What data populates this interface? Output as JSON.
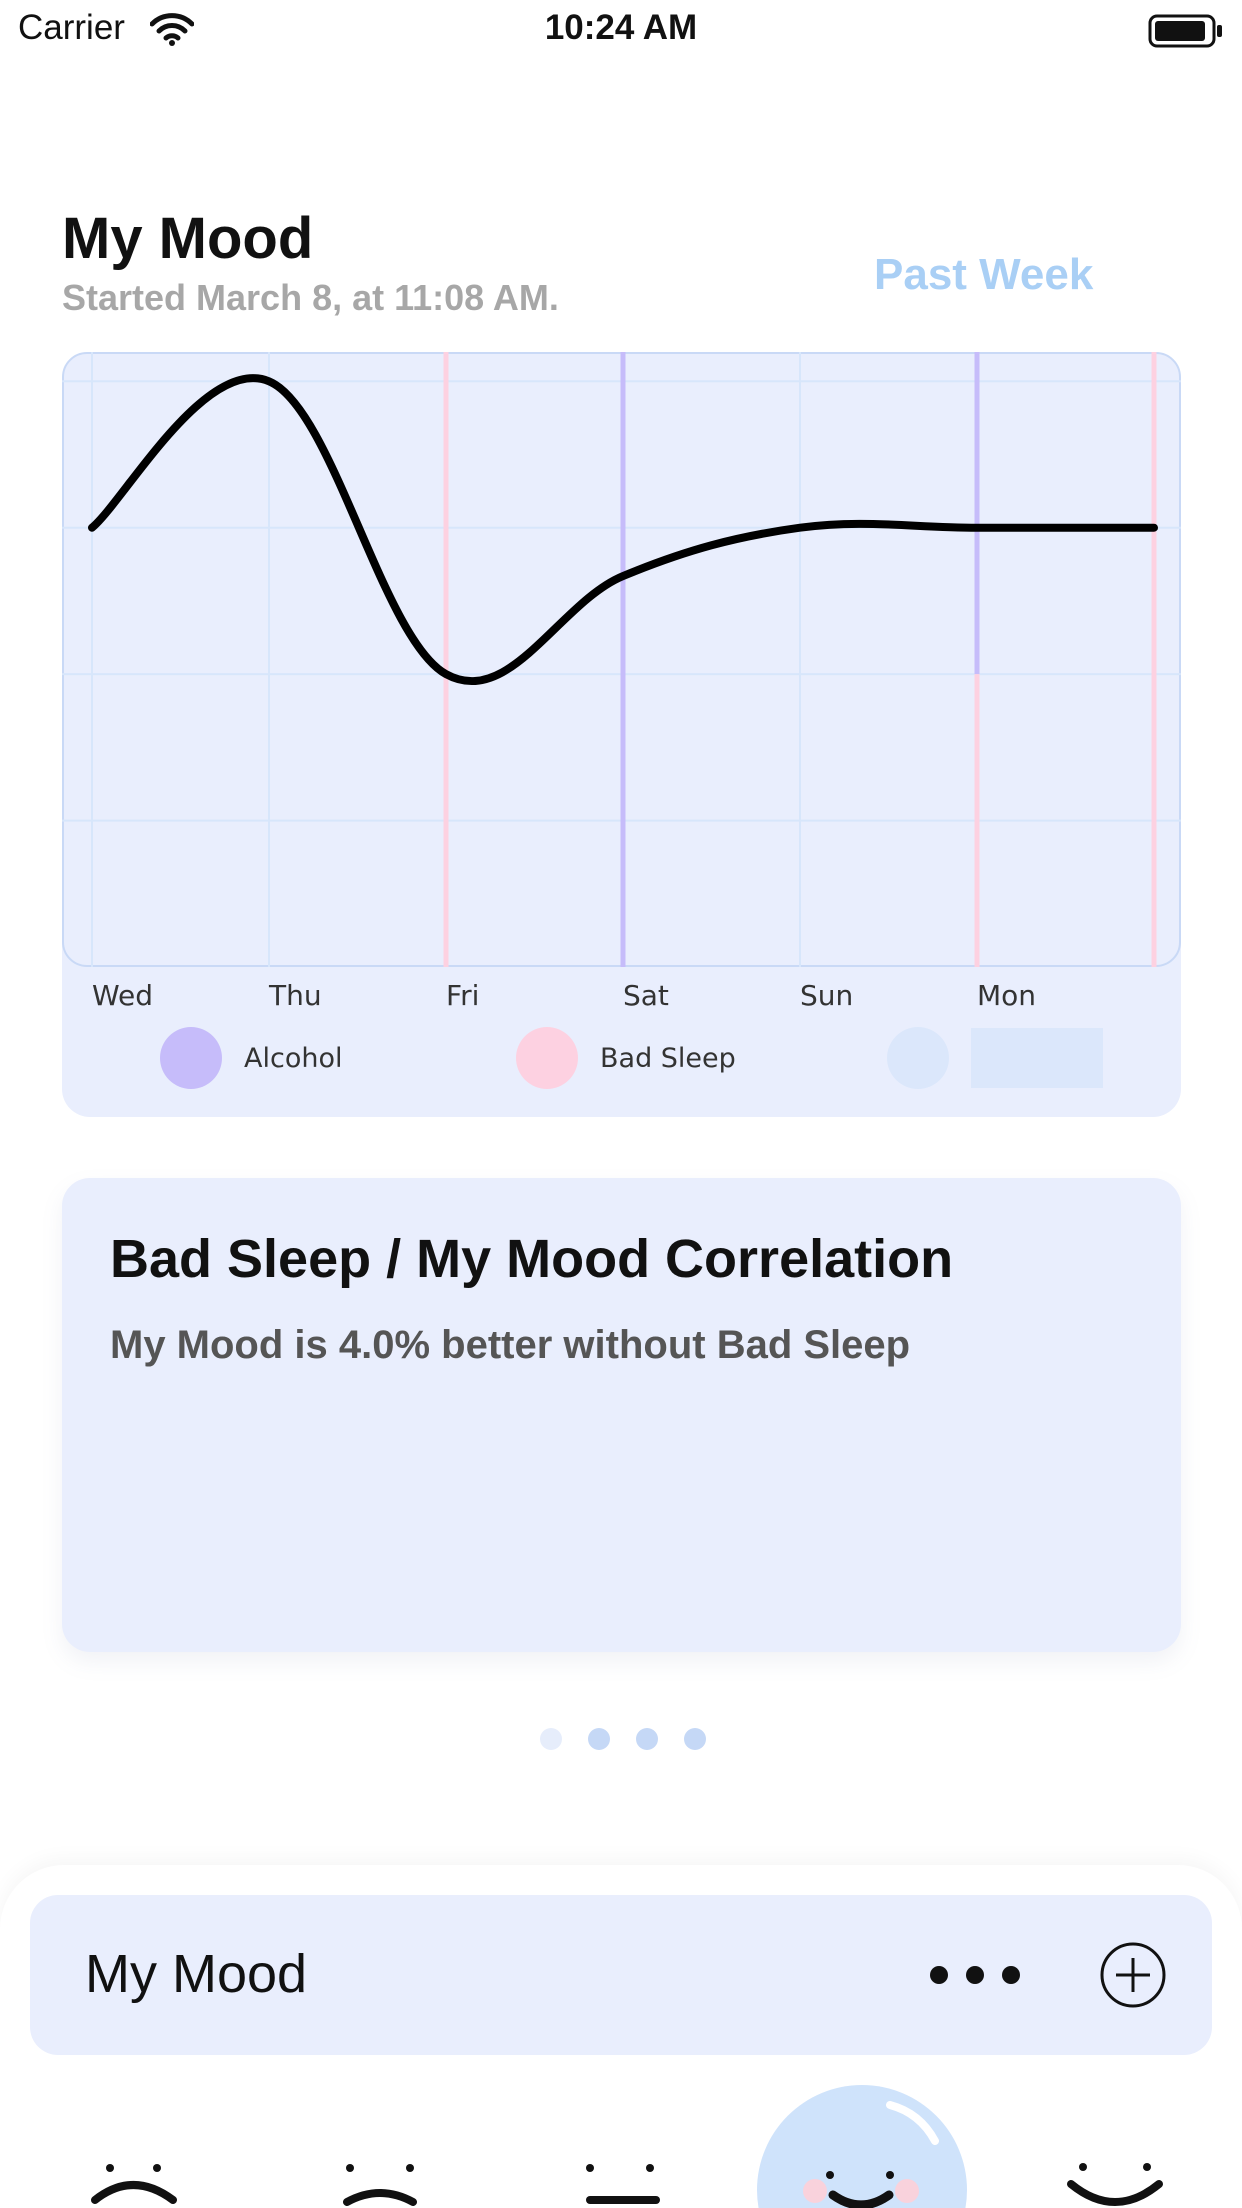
{
  "status_bar": {
    "carrier": "Carrier",
    "time": "10:24 AM"
  },
  "header": {
    "title": "My Mood",
    "subtitle": "Started March 8, at 11:08 AM.",
    "period": "Past Week"
  },
  "chart_data": {
    "type": "line",
    "x": [
      "Wed",
      "Thu",
      "Fri",
      "Sat",
      "Sun",
      "Mon",
      ""
    ],
    "series": [
      {
        "values": [
          3,
          4,
          2,
          2.67,
          3,
          3,
          3
        ]
      }
    ],
    "ylim": [
      0,
      4.2
    ],
    "grid": true,
    "event_markers": [
      {
        "x_index": 2,
        "event": "Bad Sleep",
        "y_from": 0,
        "y_to": 4.2
      },
      {
        "x_index": 3,
        "event": "Alcohol",
        "y_from": 0,
        "y_to": 4.2
      },
      {
        "x_index": 5,
        "event": "Alcohol",
        "y_from": 2,
        "y_to": 4.2
      },
      {
        "x_index": 5,
        "event": "Bad Sleep",
        "y_from": 0,
        "y_to": 2
      },
      {
        "x_index": 6,
        "event": "Bad Sleep",
        "y_from": 0,
        "y_to": 4.2
      }
    ],
    "legend": [
      "Alcohol",
      "Bad Sleep",
      ""
    ],
    "colors": {
      "line": "#000000",
      "Alcohol": "#c6bcfa",
      "Bad Sleep": "#fdd1e1",
      "grid": "#d7e6fb",
      "plot_background": "#e9eefd",
      "third": "#dbe7fb"
    }
  },
  "legend": {
    "alcohol": "Alcohol",
    "bad_sleep": "Bad Sleep"
  },
  "correlation": {
    "title": "Bad Sleep / My Mood Correlation",
    "text": "My Mood is 4.0% better without Bad Sleep"
  },
  "pager": {
    "count": 4,
    "active_index": 0
  },
  "sheet": {
    "title": "My Mood",
    "more_icon": "more-horizontal-icon",
    "add_icon": "plus-circle-icon"
  },
  "faces": [
    "very-sad-face-icon",
    "sad-face-icon",
    "neutral-face-icon",
    "happy-face-icon-selected",
    "very-happy-face-icon"
  ],
  "colors": {
    "accent": "#a9cff5",
    "card": "#e9eefd",
    "selected_face": "#cfe3fb"
  }
}
